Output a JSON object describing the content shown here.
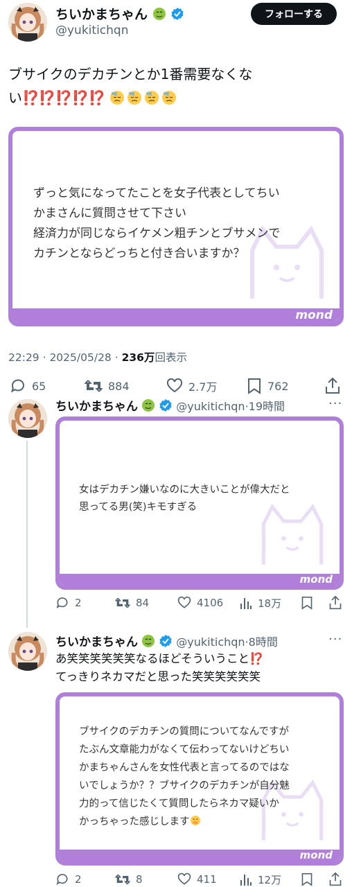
{
  "main": {
    "display_name": "ちいかまちゃん",
    "handle": "@yukitichqn",
    "follow_label": "フォローする",
    "text_line1": "ブサイクのデカチンとか1番需要なくな",
    "text_line2_prefix": "い",
    "interrobang": "⁉️",
    "card": {
      "question_lines": [
        "ずっと気になってたことを女子代表としてちい",
        "かまさんに質問させて下さい",
        "経済力が同じならイケメン粗チンとブサメンで",
        "カチンとならどっちと付き合いますか？"
      ],
      "brand": "mond"
    },
    "time": "22:29 · 2025/05/28 · ",
    "views_count": "236万",
    "views_label": "回表示",
    "actions": {
      "replies": "65",
      "reposts": "884",
      "likes": "2.7万",
      "bookmarks": "762"
    }
  },
  "replies": [
    {
      "display_name": "ちいかまちゃん",
      "handle": "@yukitichqn",
      "time": "19時間",
      "card": {
        "question_lines": [
          "女はデカチン嫌いなのに大きいことが偉大だと",
          "思ってる男(笑)キモすぎる"
        ],
        "brand": "mond"
      },
      "actions": {
        "replies": "2",
        "reposts": "84",
        "likes": "4106",
        "views": "18万"
      }
    },
    {
      "display_name": "ちいかまちゃん",
      "handle": "@yukitichqn",
      "time": "8時間",
      "text_line1": "あ笑笑笑笑笑笑なるほどそういうこと",
      "text_line2": "てっきりネカマだと思った笑笑笑笑笑笑",
      "interrobang": "⁉️",
      "card": {
        "question_lines": [
          "ブサイクのデカチンの質問についてなんですが",
          "たぶん文章能力がなくて伝わってないけどちい",
          "かまちゃんさんを女性代表と言ってるのではな",
          "いでしょうか？？ブサイクのデカチンが自分魅",
          "力的って信じたくて質問したらネカマ疑いか",
          "かっちゃった感じします"
        ],
        "brand": "mond"
      },
      "actions": {
        "replies": "2",
        "reposts": "8",
        "likes": "411",
        "views": "12万"
      }
    }
  ]
}
